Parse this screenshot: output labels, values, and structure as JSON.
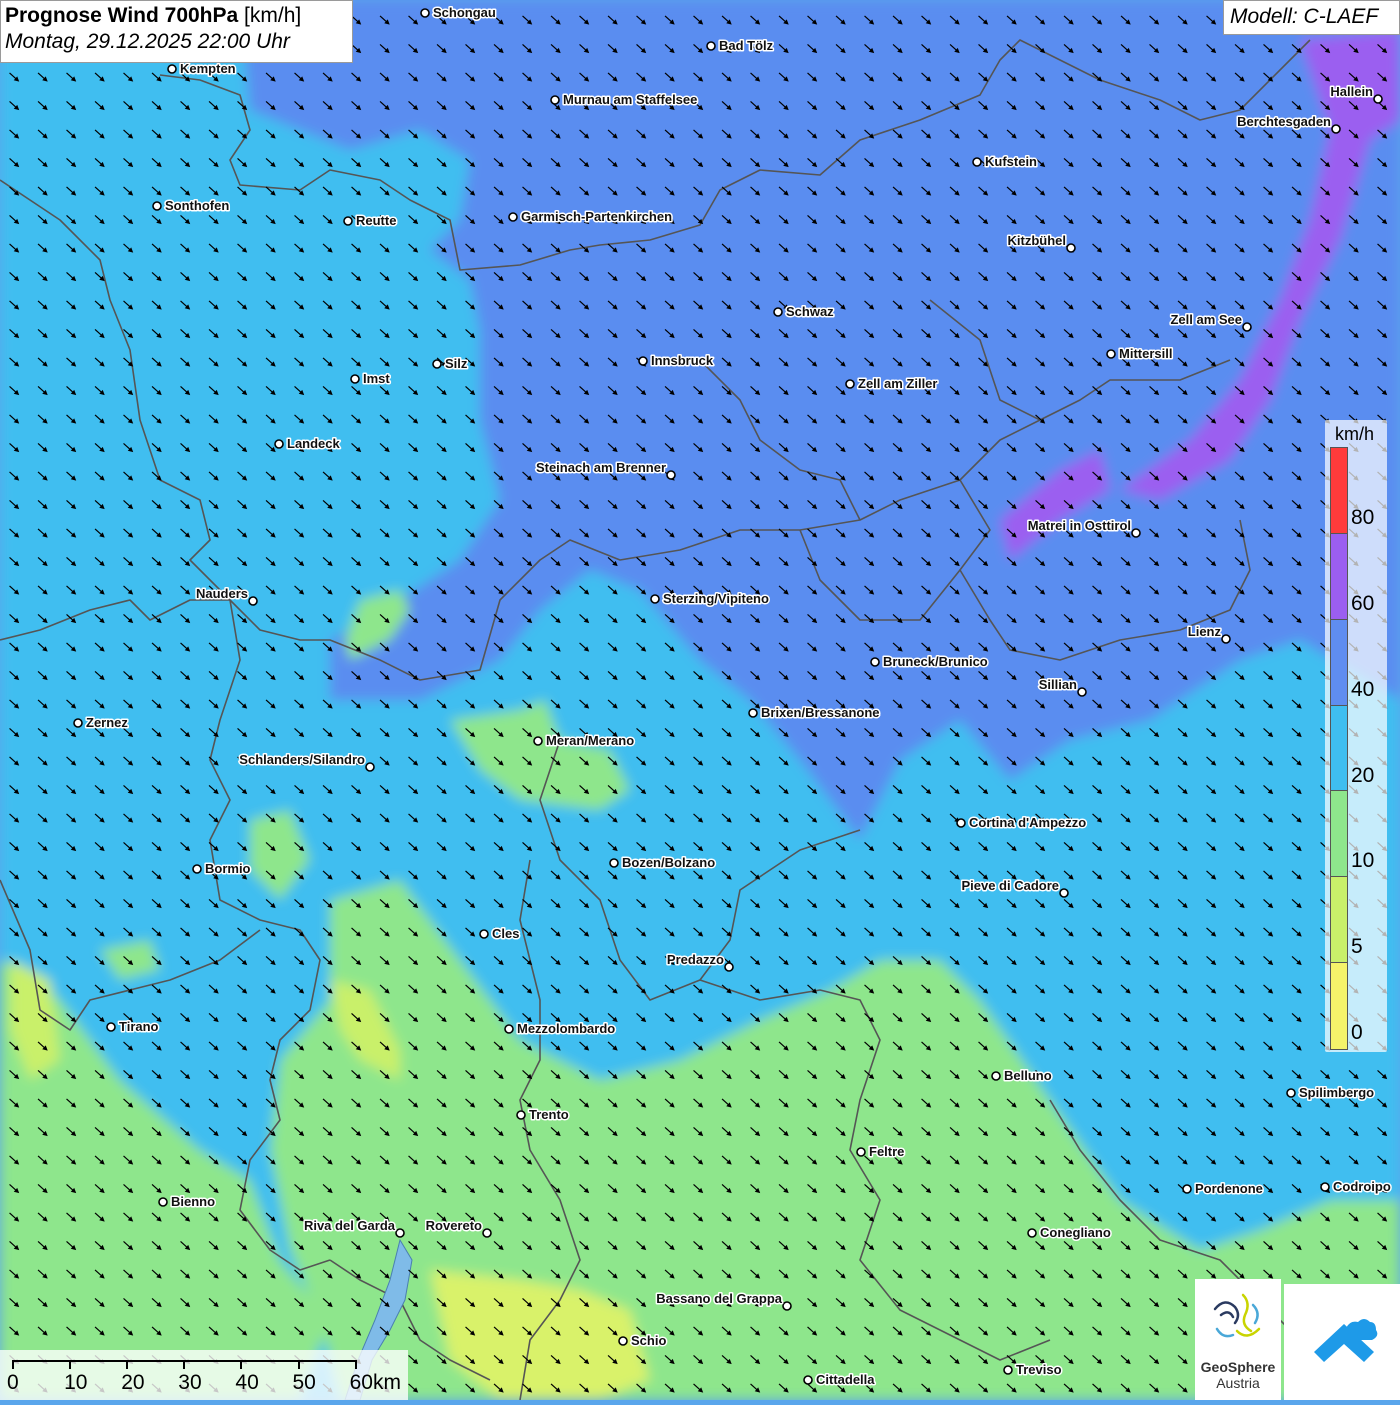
{
  "header": {
    "title_bold": "Prognose Wind 700hPa",
    "title_unit": " [km/h]",
    "subtitle": "Montag, 29.12.2025 22:00 Uhr",
    "model": "Modell: C-LAEF"
  },
  "colors": {
    "level_0_5": "#f5f36a",
    "level_5_10": "#c9f06a",
    "level_10_20": "#8ee68c",
    "level_20_40": "#3fbef0",
    "level_40_60": "#5a8df0",
    "level_60_80": "#9b5ef0",
    "level_80_plus": "#f03030",
    "borders": "#555555",
    "arrows": "#000000"
  },
  "legend": {
    "unit": "km/h",
    "ticks": [
      "80",
      "60",
      "40",
      "20",
      "10",
      "5",
      "0"
    ],
    "segment_colors": [
      "#ff3b3b",
      "#9b5ef0",
      "#5f8df0",
      "#3fbef0",
      "#8ee68c",
      "#c9f06a",
      "#f5f36a"
    ]
  },
  "scale": {
    "labels": [
      "0",
      "10",
      "20",
      "30",
      "40",
      "50",
      "60km"
    ]
  },
  "logo": {
    "name": "GeoSphere",
    "sub": "Austria"
  },
  "places": [
    {
      "name": "Schongau",
      "label_side": "right"
    },
    {
      "name": "Bad Tölz",
      "label_side": "right"
    },
    {
      "name": "Kempten",
      "label_side": "right"
    },
    {
      "name": "Murnau am Staffelsee",
      "label_side": "right"
    },
    {
      "name": "Hallein",
      "label_side": "left"
    },
    {
      "name": "Berchtesgaden",
      "label_side": "left"
    },
    {
      "name": "Kufstein",
      "label_side": "right"
    },
    {
      "name": "Sonthofen",
      "label_side": "right"
    },
    {
      "name": "Reutte",
      "label_side": "right"
    },
    {
      "name": "Garmisch-Partenkirchen",
      "label_side": "right"
    },
    {
      "name": "Kitzbühel",
      "label_side": "left"
    },
    {
      "name": "Schwaz",
      "label_side": "right"
    },
    {
      "name": "Zell am See",
      "label_side": "left"
    },
    {
      "name": "Innsbruck",
      "label_side": "right"
    },
    {
      "name": "Mittersill",
      "label_side": "right"
    },
    {
      "name": "Silz",
      "label_side": "right"
    },
    {
      "name": "Imst",
      "label_side": "right"
    },
    {
      "name": "Zell am Ziller",
      "label_side": "right"
    },
    {
      "name": "Landeck",
      "label_side": "right"
    },
    {
      "name": "Steinach am Brenner",
      "label_side": "left"
    },
    {
      "name": "Matrei in Osttirol",
      "label_side": "left"
    },
    {
      "name": "Nauders",
      "label_side": "left"
    },
    {
      "name": "Sterzing/Vipiteno",
      "label_side": "right"
    },
    {
      "name": "Lienz",
      "label_side": "left"
    },
    {
      "name": "Bruneck/Brunico",
      "label_side": "right"
    },
    {
      "name": "Sillian",
      "label_side": "left"
    },
    {
      "name": "Zernez",
      "label_side": "right"
    },
    {
      "name": "Brixen/Bressanone",
      "label_side": "right"
    },
    {
      "name": "Meran/Merano",
      "label_side": "right"
    },
    {
      "name": "Schlanders/Silandro",
      "label_side": "left"
    },
    {
      "name": "Cortina d'Ampezzo",
      "label_side": "right"
    },
    {
      "name": "Bozen/Bolzano",
      "label_side": "right"
    },
    {
      "name": "Bormio",
      "label_side": "right"
    },
    {
      "name": "Pieve di Cadore",
      "label_side": "left"
    },
    {
      "name": "Cles",
      "label_side": "right"
    },
    {
      "name": "Predazzo",
      "label_side": "left"
    },
    {
      "name": "Tirano",
      "label_side": "right"
    },
    {
      "name": "Mezzolombardo",
      "label_side": "right"
    },
    {
      "name": "Belluno",
      "label_side": "right"
    },
    {
      "name": "Spilimbergo",
      "label_side": "right"
    },
    {
      "name": "Trento",
      "label_side": "right"
    },
    {
      "name": "Feltre",
      "label_side": "right"
    },
    {
      "name": "Pordenone",
      "label_side": "right"
    },
    {
      "name": "Codroipo",
      "label_side": "right"
    },
    {
      "name": "Bienno",
      "label_side": "right"
    },
    {
      "name": "Riva del Garda",
      "label_side": "left"
    },
    {
      "name": "Rovereto",
      "label_side": "left"
    },
    {
      "name": "Conegliano",
      "label_side": "right"
    },
    {
      "name": "Bassano del Grappa",
      "label_side": "left"
    },
    {
      "name": "Schio",
      "label_side": "right"
    },
    {
      "name": "Treviso",
      "label_side": "right"
    },
    {
      "name": "Cittadella",
      "label_side": "right"
    }
  ]
}
